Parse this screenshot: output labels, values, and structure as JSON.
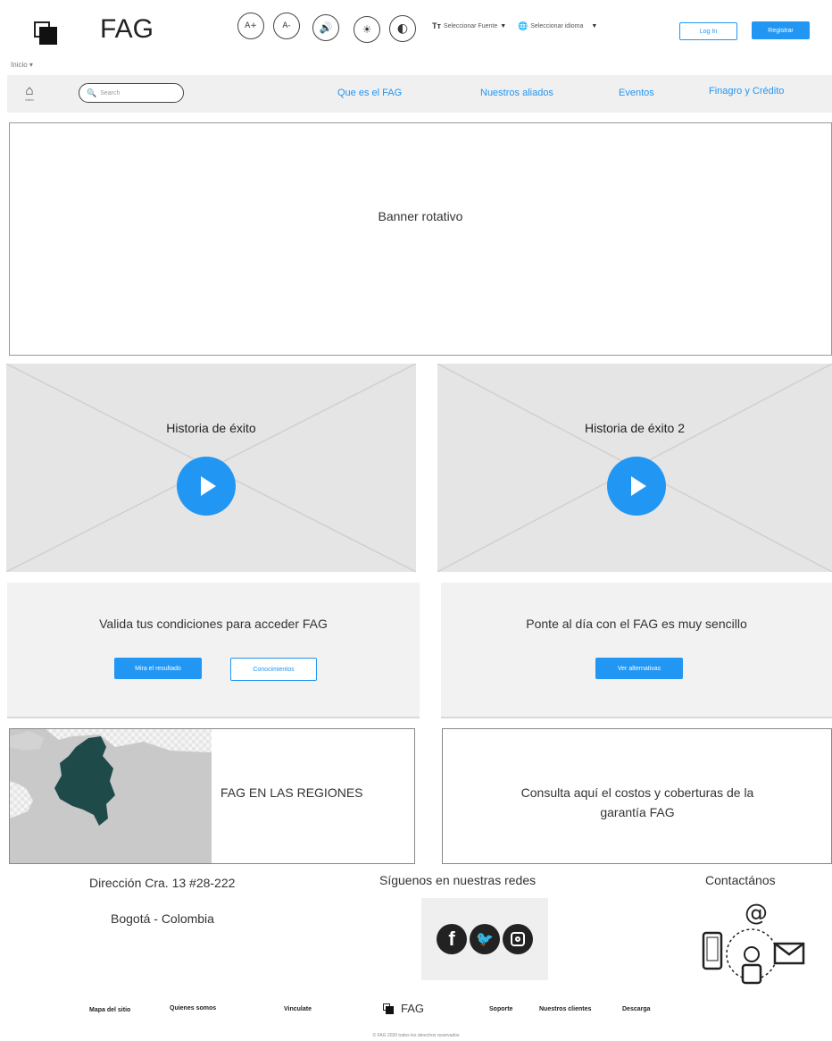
{
  "header": {
    "brand": "FAG",
    "font_increase": "A+",
    "font_decrease": "A-",
    "font_select": "Seleccionar Fuente",
    "language_select": "Seleccionar idioma",
    "login_label": "Log In",
    "register_label": "Registrar"
  },
  "breadcrumb": "Inicio",
  "nav": {
    "home_label": "Inicio",
    "search_placeholder": "Search",
    "links": [
      "Que es el FAG",
      "Nuestros aliados",
      "Eventos",
      "Finagro y Crédito"
    ]
  },
  "banner": {
    "label": "Banner rotativo"
  },
  "videos": [
    {
      "title": "Historia de éxito"
    },
    {
      "title": "Historia de éxito 2"
    }
  ],
  "cards": {
    "validate": {
      "text": "Valida tus condiciones para acceder FAG",
      "primary_button": "Mira el resultado",
      "secondary_button": "Conocimientos"
    },
    "upToDate": {
      "text": "Ponte al día con el FAG es muy sencillo",
      "button": "Ver alternativas"
    },
    "regions": {
      "text": "FAG EN LAS REGIONES"
    },
    "costs": {
      "text": "Consulta aquí el costos y coberturas de la garantía FAG"
    }
  },
  "footer": {
    "address": "Dirección Cra. 13 #28-222",
    "city": "Bogotá - Colombia",
    "social_title": "Síguenos en nuestras redes",
    "contact_title": "Contactános",
    "links_left": [
      "Mapa del sitio",
      "Quienes somos",
      "Vinculate"
    ],
    "brand": "FAG",
    "links_right": [
      "Soporte",
      "Nuestros clientes",
      "Descarga"
    ],
    "copyright": "© FAG 2020 todos los derechos reservados"
  },
  "colors": {
    "accent": "#2196f3",
    "map_highlight": "#1f4a4a",
    "panel_gray": "#e5e5e5"
  }
}
